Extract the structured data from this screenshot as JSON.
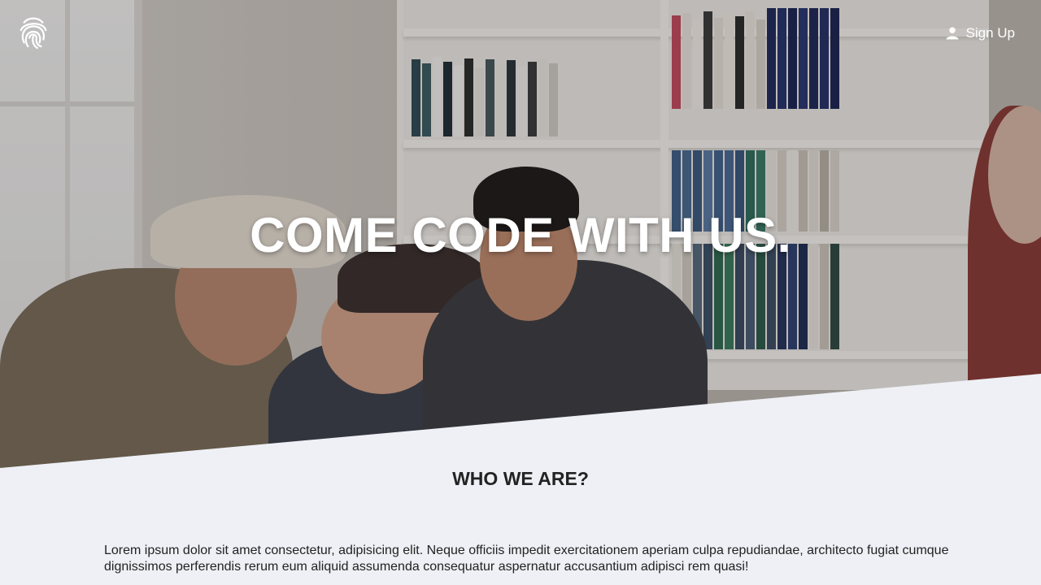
{
  "header": {
    "logo_icon": "fingerprint-icon",
    "signup_icon": "person-icon",
    "signup_label": "Sign Up"
  },
  "hero": {
    "title": "COME CODE WITH US."
  },
  "about": {
    "title": "WHO WE ARE?",
    "text": "Lorem ipsum dolor sit amet consectetur, adipisicing elit. Neque officiis impedit exercitationem aperiam culpa repudiandae, architecto fugiat cumque dignissimos perferendis rerum eum aliquid assumenda consequatur aspernatur accusantium adipisci rem quasi!"
  },
  "colors": {
    "section_bg": "#eef0f5",
    "hero_text": "#ffffff",
    "heading_text": "#232323"
  }
}
